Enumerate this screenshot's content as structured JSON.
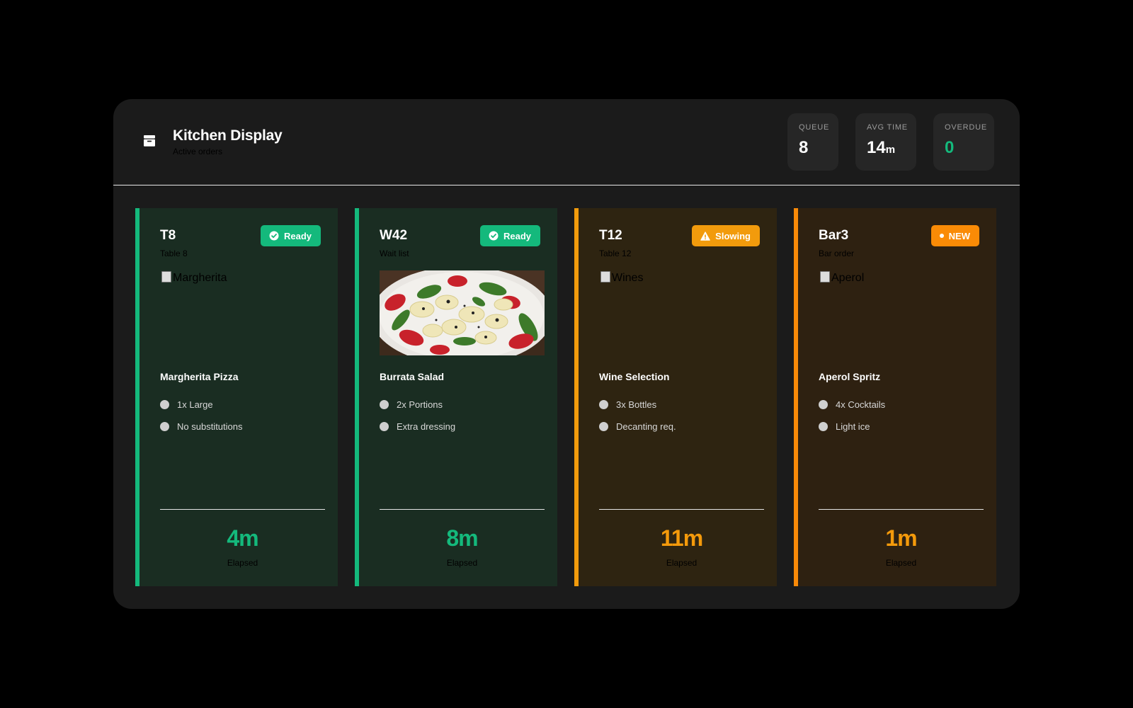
{
  "header": {
    "title": "Kitchen Display",
    "subtitle": "Active orders",
    "logo_icon": "kitchen-box-icon"
  },
  "stats": [
    {
      "label": "QUEUE",
      "value": "8",
      "unit": ""
    },
    {
      "label": "AVG TIME",
      "value": "14",
      "unit": "m"
    },
    {
      "label": "OVERDUE",
      "value": "0",
      "unit": ""
    }
  ],
  "colors": {
    "ready": "#14b97c",
    "slowing": "#f29b0c",
    "new": "#fa8b06",
    "panel": "#1b1b1b"
  },
  "orders": [
    {
      "id": "T8",
      "location": "Table 8",
      "status": "Ready",
      "status_icon": "check-circle-icon",
      "image_alt": "Margherita",
      "dish": "Margherita Pizza",
      "items": [
        "1x Large",
        "No substitutions"
      ],
      "elapsed": "4m",
      "elapsed_label": "Elapsed"
    },
    {
      "id": "W42",
      "location": "Wait list",
      "status": "Ready",
      "status_icon": "check-circle-icon",
      "image_alt": "Burrata",
      "dish": "Burrata Salad",
      "items": [
        "2x Portions",
        "Extra dressing"
      ],
      "elapsed": "8m",
      "elapsed_label": "Elapsed"
    },
    {
      "id": "T12",
      "location": "Table 12",
      "status": "Slowing",
      "status_icon": "warning-triangle-icon",
      "image_alt": "Wines",
      "dish": "Wine Selection",
      "items": [
        "3x Bottles",
        "Decanting req."
      ],
      "elapsed": "11m",
      "elapsed_label": "Elapsed"
    },
    {
      "id": "Bar3",
      "location": "Bar order",
      "status": "NEW",
      "status_icon": "dot-icon",
      "image_alt": "Aperol",
      "dish": "Aperol Spritz",
      "items": [
        "4x Cocktails",
        "Light ice"
      ],
      "elapsed": "1m",
      "elapsed_label": "Elapsed"
    }
  ]
}
